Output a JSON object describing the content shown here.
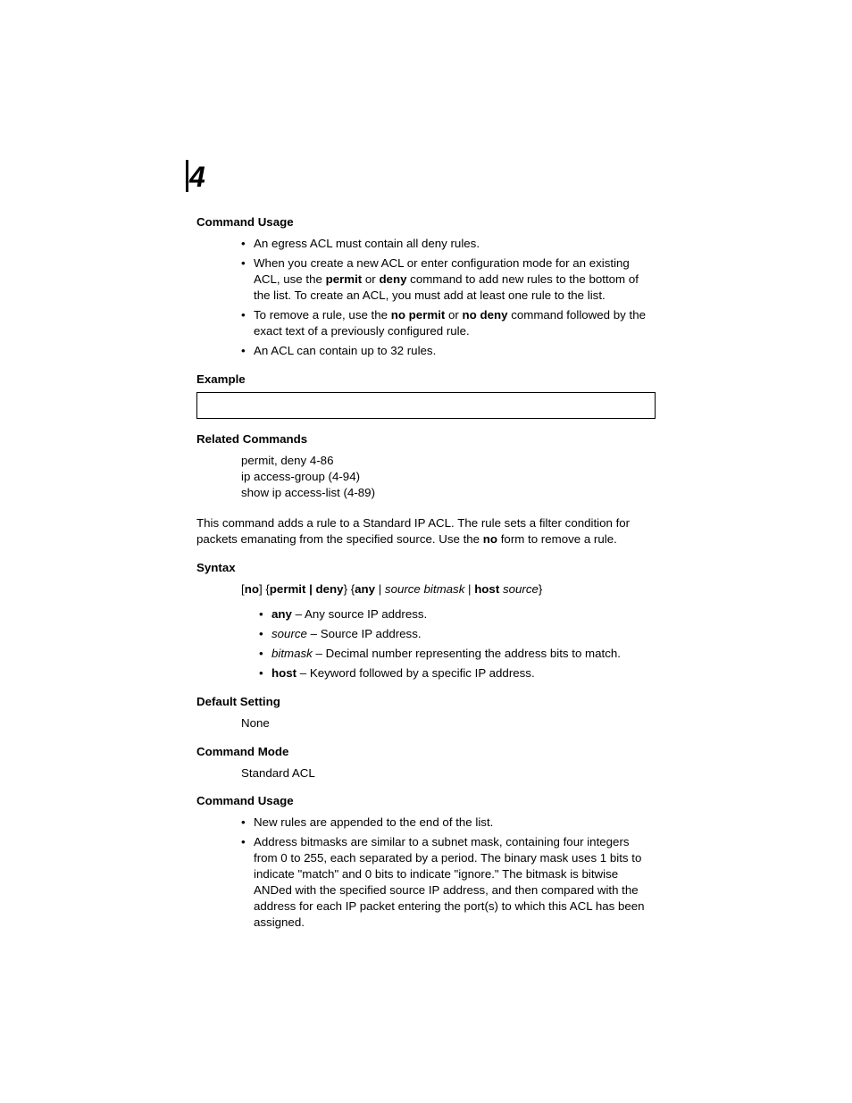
{
  "chapter": "4",
  "s1_head": "Command Usage",
  "s1_b1": "An egress ACL must contain all deny rules.",
  "s1_b2a": "When you create a new ACL or enter configuration mode for an existing ACL, use the ",
  "s1_b2b": "permit",
  "s1_b2c": " or ",
  "s1_b2d": "deny",
  "s1_b2e": " command to add new rules to the bottom of the list. To create an ACL, you must add at least one rule to the list.",
  "s1_b3a": "To remove a rule, use the ",
  "s1_b3b": "no permit",
  "s1_b3c": " or ",
  "s1_b3d": "no deny",
  "s1_b3e": " command followed by the exact text of a previously configured rule.",
  "s1_b4": "An ACL can contain up to 32 rules.",
  "s2_head": "Example",
  "s3_head": "Related Commands",
  "s3_l1": "permit, deny 4-86",
  "s3_l2": "ip access-group (4-94)",
  "s3_l3": "show ip access-list (4-89)",
  "desc_a": "This command adds a rule to a Standard IP ACL. The rule sets a filter condition for packets emanating from the specified source. Use the ",
  "desc_b": "no",
  "desc_c": " form to remove a rule.",
  "s4_head": "Syntax",
  "syn_a": "[",
  "syn_b": "no",
  "syn_c": "] {",
  "syn_d": "permit | deny",
  "syn_e": "} {",
  "syn_f": "any",
  "syn_g": " | ",
  "syn_h": "source bitmask",
  "syn_i": " | ",
  "syn_j": "host",
  "syn_k": " ",
  "syn_l": "source",
  "syn_m": "}",
  "s4_b1a": "any",
  "s4_b1b": " – Any source IP address.",
  "s4_b2a": "source",
  "s4_b2b": " – Source IP address.",
  "s4_b3a": "bitmask",
  "s4_b3b": " – Decimal number representing the address bits to match.",
  "s4_b4a": "host",
  "s4_b4b": " – Keyword followed by a specific IP address.",
  "s5_head": "Default Setting",
  "s5_val": "None",
  "s6_head": "Command Mode",
  "s6_val": "Standard ACL",
  "s7_head": "Command Usage",
  "s7_b1": "New rules are appended to the end of the list.",
  "s7_b2": "Address bitmasks are similar to a subnet mask, containing four integers from 0 to 255, each separated by a period. The binary mask uses 1 bits to indicate \"match\" and 0 bits to indicate \"ignore.\" The bitmask is bitwise ANDed with the specified source IP address, and then compared with the address for each IP packet entering the port(s) to which this ACL has been assigned."
}
